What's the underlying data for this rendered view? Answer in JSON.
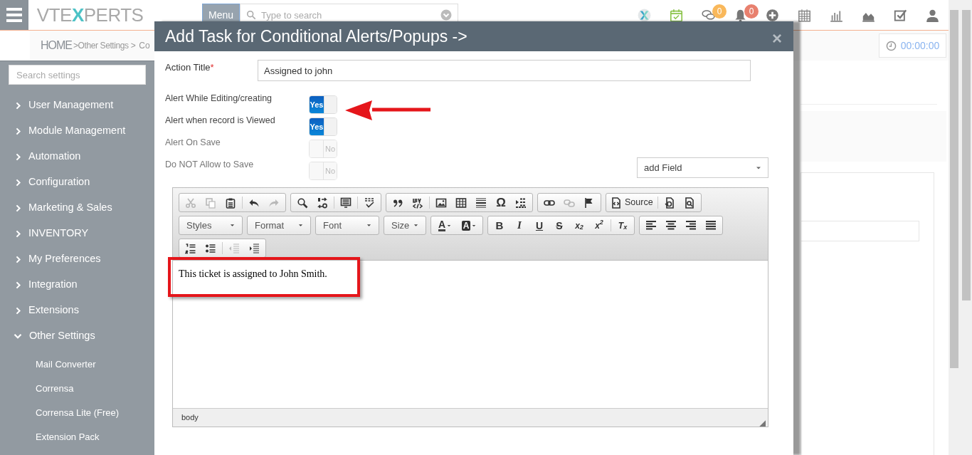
{
  "header": {
    "logo": {
      "parts": [
        "VTE",
        "X",
        "PERTS"
      ]
    },
    "menu_button": "Menu",
    "search": {
      "placeholder": "Type to search"
    },
    "notifications": [
      {
        "count": "0",
        "color": "#f9b85b"
      },
      {
        "count": "0",
        "color": "#e8806e"
      }
    ]
  },
  "breadcrumb": [
    "HOME",
    ">Other Settings >",
    "Co"
  ],
  "timer": "00:00:00",
  "sidebar": {
    "search": {
      "placeholder": "Search settings"
    },
    "items": [
      {
        "label": "User Management",
        "expanded": false
      },
      {
        "label": "Module Management",
        "expanded": false
      },
      {
        "label": "Automation",
        "expanded": false
      },
      {
        "label": "Configuration",
        "expanded": false
      },
      {
        "label": "Marketing & Sales",
        "expanded": false
      },
      {
        "label": "INVENTORY",
        "expanded": false
      },
      {
        "label": "My Preferences",
        "expanded": false
      },
      {
        "label": "Integration",
        "expanded": false
      },
      {
        "label": "Extensions",
        "expanded": false
      },
      {
        "label": "Other Settings",
        "expanded": true,
        "children": [
          {
            "label": "Mail Converter"
          },
          {
            "label": "Corrensa"
          },
          {
            "label": "Corrensa Lite (Free)"
          },
          {
            "label": "Extension Pack"
          }
        ]
      }
    ]
  },
  "modal": {
    "title": "Add Task for Conditional Alerts/Popups ->",
    "close": "×",
    "action_title": {
      "label": "Action Title",
      "required_mark": "*",
      "value": "Assigned to john"
    },
    "toggles": [
      {
        "label": "Alert While Editing/creating",
        "on": true,
        "text": "Yes"
      },
      {
        "label": "Alert when record is Viewed",
        "on": true,
        "text": "Yes"
      },
      {
        "label": "Alert On Save",
        "on": false,
        "text": "No"
      },
      {
        "label": "Do NOT Allow to Save",
        "on": false,
        "text": "No"
      }
    ],
    "add_field": {
      "value": "add Field"
    },
    "editor": {
      "toolbar": [
        [
          [
            {
              "kind": "icon",
              "disabled": true
            },
            {
              "kind": "icon",
              "disabled": true
            },
            {
              "kind": "icon",
              "disabled": false
            },
            {
              "kind": "separator"
            },
            {
              "kind": "icon",
              "disabled": false
            },
            {
              "kind": "icon",
              "disabled": true
            }
          ],
          [
            {
              "kind": "icon",
              "disabled": false
            },
            {
              "kind": "icon",
              "disabled": false
            },
            {
              "kind": "separator"
            },
            {
              "kind": "icon",
              "disabled": false
            },
            {
              "kind": "separator"
            },
            {
              "kind": "icon",
              "disabled": false
            }
          ],
          [
            {
              "kind": "icon",
              "disabled": false
            },
            {
              "kind": "icon",
              "disabled": false
            },
            {
              "kind": "separator"
            },
            {
              "kind": "icon",
              "disabled": false
            },
            {
              "kind": "icon",
              "disabled": false
            },
            {
              "kind": "icon",
              "disabled": false
            },
            {
              "kind": "text",
              "label": "Ω",
              "disabled": false
            },
            {
              "kind": "icon",
              "disabled": false
            }
          ],
          [
            {
              "kind": "icon",
              "disabled": false
            },
            {
              "kind": "icon",
              "disabled": true
            },
            {
              "kind": "icon",
              "disabled": false
            }
          ],
          [
            {
              "kind": "labeled",
              "label": "Source",
              "disabled": false
            },
            {
              "kind": "separator"
            },
            {
              "kind": "icon",
              "disabled": false
            },
            {
              "kind": "icon",
              "disabled": false
            }
          ]
        ],
        [
          [
            {
              "kind": "dropdown",
              "label": "Styles"
            }
          ],
          [
            {
              "kind": "dropdown",
              "label": "Format"
            }
          ],
          [
            {
              "kind": "dropdown",
              "label": "Font"
            }
          ],
          [
            {
              "kind": "dropdown",
              "label": "Size"
            }
          ],
          [
            {
              "kind": "text-color",
              "label": "A",
              "disabled": false
            },
            {
              "kind": "background-color",
              "label": "A",
              "disabled": false
            }
          ],
          [
            {
              "kind": "text",
              "label": "B",
              "disabled": false
            },
            {
              "kind": "text",
              "label": "I",
              "disabled": false
            },
            {
              "kind": "text",
              "label": "U",
              "disabled": false
            },
            {
              "kind": "text",
              "label": "S",
              "disabled": false
            },
            {
              "kind": "text",
              "label": "x$_{2}$",
              "disabled": false
            },
            {
              "kind": "text",
              "label": "x$^{2}$",
              "disabled": false
            },
            {
              "kind": "separator"
            },
            {
              "kind": "text",
              "label": "T$_{x}$",
              "disabled": false
            }
          ],
          [
            {
              "kind": "icon",
              "disabled": false
            },
            {
              "kind": "icon",
              "disabled": false
            },
            {
              "kind": "icon",
              "disabled": false
            },
            {
              "kind": "icon",
              "disabled": false
            }
          ]
        ],
        [
          [
            {
              "kind": "icon",
              "disabled": false
            },
            {
              "kind": "icon",
              "disabled": false
            },
            {
              "kind": "separator"
            },
            {
              "kind": "icon",
              "disabled": true
            },
            {
              "kind": "icon",
              "disabled": false
            }
          ]
        ]
      ],
      "content": "This ticket is assigned to John Smith.",
      "status": "body"
    }
  }
}
